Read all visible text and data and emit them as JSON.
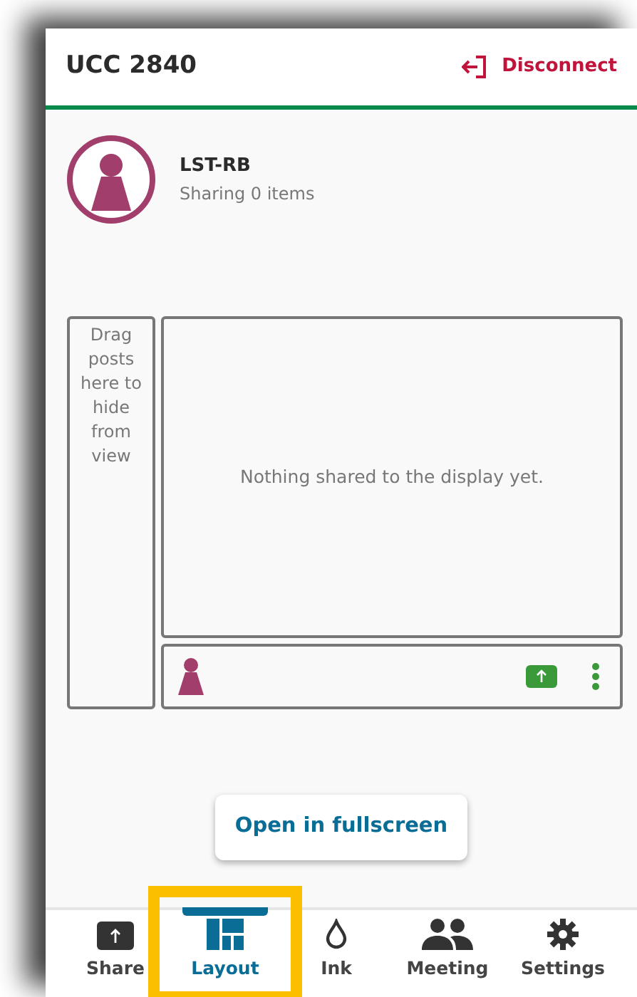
{
  "header": {
    "title": "UCC 2840",
    "action": "Disconnect"
  },
  "user": {
    "name": "LST-RB",
    "status": "Sharing 0 items"
  },
  "layout": {
    "hidden_zone": "Drag posts here to hide from view",
    "empty_message": "Nothing shared to the display yet."
  },
  "fullscreen_button": "Open in fullscreen",
  "tabs": [
    {
      "label": "Share",
      "kind": "share",
      "selected": false,
      "highlighted": false
    },
    {
      "label": "Layout",
      "kind": "layout",
      "selected": true,
      "highlighted": true
    },
    {
      "label": "Ink",
      "kind": "ink",
      "selected": false,
      "highlighted": false
    },
    {
      "label": "Meeting",
      "kind": "meeting",
      "selected": false,
      "highlighted": false
    },
    {
      "label": "Settings",
      "kind": "settings",
      "selected": false,
      "highlighted": false
    }
  ]
}
